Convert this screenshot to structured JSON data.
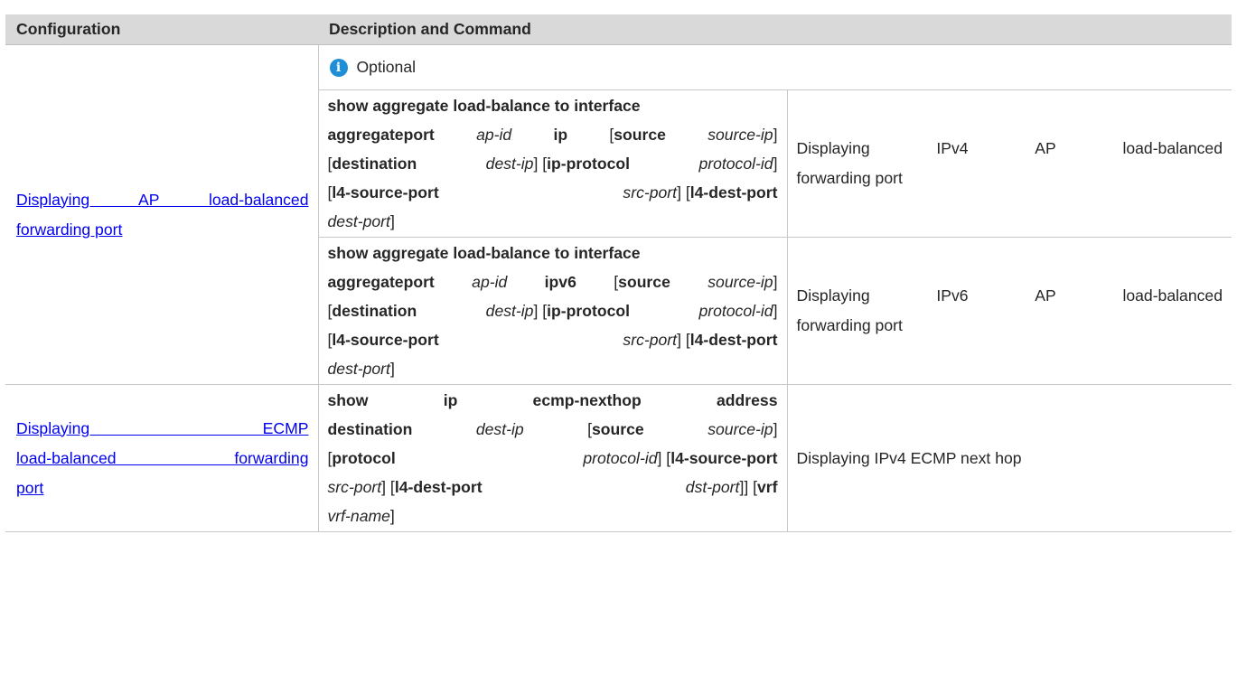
{
  "table": {
    "headers": [
      "Configuration",
      "Description and Command"
    ],
    "optional_label": "Optional",
    "rows": [
      {
        "config_link_lines": [
          "Displaying AP load-balanced",
          "forwarding port"
        ],
        "commands": [
          {
            "lines": [
              [
                {
                  "t": "show aggregate load-balance to interface",
                  "s": "b"
                }
              ],
              [
                {
                  "t": "aggregateport",
                  "s": "b"
                },
                {
                  "t": "ap-id",
                  "s": "i"
                },
                {
                  "t": "ip",
                  "s": "b"
                },
                {
                  "t": "[",
                  "s": "n"
                },
                {
                  "t": "source",
                  "s": "b"
                },
                {
                  "t": "source-ip",
                  "s": "i"
                },
                {
                  "t": "]",
                  "s": "n"
                }
              ],
              [
                {
                  "t": "[",
                  "s": "n"
                },
                {
                  "t": "destination",
                  "s": "b"
                },
                {
                  "t": "dest-ip",
                  "s": "i"
                },
                {
                  "t": "] [",
                  "s": "n"
                },
                {
                  "t": "ip-protocol",
                  "s": "b"
                },
                {
                  "t": "protocol-id",
                  "s": "i"
                },
                {
                  "t": "]",
                  "s": "n"
                }
              ],
              [
                {
                  "t": "[",
                  "s": "n"
                },
                {
                  "t": "l4-source-port",
                  "s": "b"
                },
                {
                  "t": "src-port",
                  "s": "i"
                },
                {
                  "t": "] [",
                  "s": "n"
                },
                {
                  "t": "l4-dest-port",
                  "s": "b"
                }
              ],
              [
                {
                  "t": "dest-port",
                  "s": "i"
                },
                {
                  "t": "]",
                  "s": "n"
                }
              ]
            ],
            "description_lines": [
              "Displaying IPv4 AP load-balanced",
              "forwarding port"
            ]
          },
          {
            "lines": [
              [
                {
                  "t": "show aggregate load-balance to interface",
                  "s": "b"
                }
              ],
              [
                {
                  "t": "aggregateport",
                  "s": "b"
                },
                {
                  "t": "ap-id",
                  "s": "i"
                },
                {
                  "t": "ipv6",
                  "s": "b"
                },
                {
                  "t": "[",
                  "s": "n"
                },
                {
                  "t": "source",
                  "s": "b"
                },
                {
                  "t": "source-ip",
                  "s": "i"
                },
                {
                  "t": "]",
                  "s": "n"
                }
              ],
              [
                {
                  "t": "[",
                  "s": "n"
                },
                {
                  "t": "destination",
                  "s": "b"
                },
                {
                  "t": "dest-ip",
                  "s": "i"
                },
                {
                  "t": "] [",
                  "s": "n"
                },
                {
                  "t": "ip-protocol",
                  "s": "b"
                },
                {
                  "t": "protocol-id",
                  "s": "i"
                },
                {
                  "t": "]",
                  "s": "n"
                }
              ],
              [
                {
                  "t": "[",
                  "s": "n"
                },
                {
                  "t": "l4-source-port",
                  "s": "b"
                },
                {
                  "t": "src-port",
                  "s": "i"
                },
                {
                  "t": "] [",
                  "s": "n"
                },
                {
                  "t": "l4-dest-port",
                  "s": "b"
                }
              ],
              [
                {
                  "t": "dest-port",
                  "s": "i"
                },
                {
                  "t": "]",
                  "s": "n"
                }
              ]
            ],
            "description_lines": [
              "Displaying IPv6 AP load-balanced",
              "forwarding port"
            ]
          }
        ]
      },
      {
        "config_link_lines": [
          "Displaying ECMP",
          "load-balanced forwarding",
          "port"
        ],
        "commands": [
          {
            "lines": [
              [
                {
                  "t": "show",
                  "s": "b"
                },
                {
                  "t": "ip",
                  "s": "b"
                },
                {
                  "t": "ecmp-nexthop",
                  "s": "b"
                },
                {
                  "t": "address",
                  "s": "b"
                }
              ],
              [
                {
                  "t": "destination",
                  "s": "b"
                },
                {
                  "t": "dest-ip",
                  "s": "i"
                },
                {
                  "t": "[",
                  "s": "n"
                },
                {
                  "t": "source",
                  "s": "b"
                },
                {
                  "t": "source-ip",
                  "s": "i"
                },
                {
                  "t": "]",
                  "s": "n"
                }
              ],
              [
                {
                  "t": "[",
                  "s": "n"
                },
                {
                  "t": "protocol",
                  "s": "b"
                },
                {
                  "t": "protocol-id",
                  "s": "i"
                },
                {
                  "t": "] [",
                  "s": "n"
                },
                {
                  "t": "l4-source-port",
                  "s": "b"
                }
              ],
              [
                {
                  "t": "src-port",
                  "s": "i"
                },
                {
                  "t": "] [",
                  "s": "n"
                },
                {
                  "t": "l4-dest-port",
                  "s": "b"
                },
                {
                  "t": "dst-port",
                  "s": "i"
                },
                {
                  "t": "]] [",
                  "s": "n"
                },
                {
                  "t": "vrf",
                  "s": "b"
                }
              ],
              [
                {
                  "t": "vrf-name",
                  "s": "i"
                },
                {
                  "t": "]",
                  "s": "n"
                }
              ]
            ],
            "description_lines": [
              "Displaying IPv4 ECMP next hop"
            ]
          }
        ]
      }
    ]
  },
  "icons": {
    "optional": "info-icon"
  },
  "colors": {
    "header_bg": "#d9d9d9",
    "link": "#0000ee",
    "info_icon": "#1e8fd6"
  }
}
